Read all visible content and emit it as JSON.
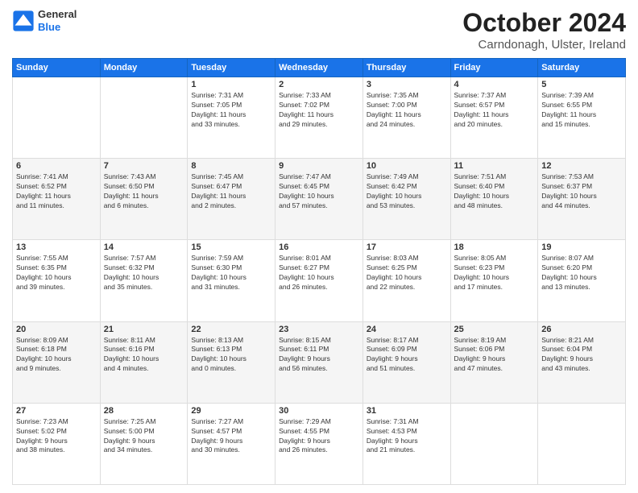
{
  "logo": {
    "line1": "General",
    "line2": "Blue"
  },
  "title": "October 2024",
  "subtitle": "Carndonagh, Ulster, Ireland",
  "days_of_week": [
    "Sunday",
    "Monday",
    "Tuesday",
    "Wednesday",
    "Thursday",
    "Friday",
    "Saturday"
  ],
  "weeks": [
    [
      {
        "day": "",
        "content": ""
      },
      {
        "day": "",
        "content": ""
      },
      {
        "day": "1",
        "content": "Sunrise: 7:31 AM\nSunset: 7:05 PM\nDaylight: 11 hours\nand 33 minutes."
      },
      {
        "day": "2",
        "content": "Sunrise: 7:33 AM\nSunset: 7:02 PM\nDaylight: 11 hours\nand 29 minutes."
      },
      {
        "day": "3",
        "content": "Sunrise: 7:35 AM\nSunset: 7:00 PM\nDaylight: 11 hours\nand 24 minutes."
      },
      {
        "day": "4",
        "content": "Sunrise: 7:37 AM\nSunset: 6:57 PM\nDaylight: 11 hours\nand 20 minutes."
      },
      {
        "day": "5",
        "content": "Sunrise: 7:39 AM\nSunset: 6:55 PM\nDaylight: 11 hours\nand 15 minutes."
      }
    ],
    [
      {
        "day": "6",
        "content": "Sunrise: 7:41 AM\nSunset: 6:52 PM\nDaylight: 11 hours\nand 11 minutes."
      },
      {
        "day": "7",
        "content": "Sunrise: 7:43 AM\nSunset: 6:50 PM\nDaylight: 11 hours\nand 6 minutes."
      },
      {
        "day": "8",
        "content": "Sunrise: 7:45 AM\nSunset: 6:47 PM\nDaylight: 11 hours\nand 2 minutes."
      },
      {
        "day": "9",
        "content": "Sunrise: 7:47 AM\nSunset: 6:45 PM\nDaylight: 10 hours\nand 57 minutes."
      },
      {
        "day": "10",
        "content": "Sunrise: 7:49 AM\nSunset: 6:42 PM\nDaylight: 10 hours\nand 53 minutes."
      },
      {
        "day": "11",
        "content": "Sunrise: 7:51 AM\nSunset: 6:40 PM\nDaylight: 10 hours\nand 48 minutes."
      },
      {
        "day": "12",
        "content": "Sunrise: 7:53 AM\nSunset: 6:37 PM\nDaylight: 10 hours\nand 44 minutes."
      }
    ],
    [
      {
        "day": "13",
        "content": "Sunrise: 7:55 AM\nSunset: 6:35 PM\nDaylight: 10 hours\nand 39 minutes."
      },
      {
        "day": "14",
        "content": "Sunrise: 7:57 AM\nSunset: 6:32 PM\nDaylight: 10 hours\nand 35 minutes."
      },
      {
        "day": "15",
        "content": "Sunrise: 7:59 AM\nSunset: 6:30 PM\nDaylight: 10 hours\nand 31 minutes."
      },
      {
        "day": "16",
        "content": "Sunrise: 8:01 AM\nSunset: 6:27 PM\nDaylight: 10 hours\nand 26 minutes."
      },
      {
        "day": "17",
        "content": "Sunrise: 8:03 AM\nSunset: 6:25 PM\nDaylight: 10 hours\nand 22 minutes."
      },
      {
        "day": "18",
        "content": "Sunrise: 8:05 AM\nSunset: 6:23 PM\nDaylight: 10 hours\nand 17 minutes."
      },
      {
        "day": "19",
        "content": "Sunrise: 8:07 AM\nSunset: 6:20 PM\nDaylight: 10 hours\nand 13 minutes."
      }
    ],
    [
      {
        "day": "20",
        "content": "Sunrise: 8:09 AM\nSunset: 6:18 PM\nDaylight: 10 hours\nand 9 minutes."
      },
      {
        "day": "21",
        "content": "Sunrise: 8:11 AM\nSunset: 6:16 PM\nDaylight: 10 hours\nand 4 minutes."
      },
      {
        "day": "22",
        "content": "Sunrise: 8:13 AM\nSunset: 6:13 PM\nDaylight: 10 hours\nand 0 minutes."
      },
      {
        "day": "23",
        "content": "Sunrise: 8:15 AM\nSunset: 6:11 PM\nDaylight: 9 hours\nand 56 minutes."
      },
      {
        "day": "24",
        "content": "Sunrise: 8:17 AM\nSunset: 6:09 PM\nDaylight: 9 hours\nand 51 minutes."
      },
      {
        "day": "25",
        "content": "Sunrise: 8:19 AM\nSunset: 6:06 PM\nDaylight: 9 hours\nand 47 minutes."
      },
      {
        "day": "26",
        "content": "Sunrise: 8:21 AM\nSunset: 6:04 PM\nDaylight: 9 hours\nand 43 minutes."
      }
    ],
    [
      {
        "day": "27",
        "content": "Sunrise: 7:23 AM\nSunset: 5:02 PM\nDaylight: 9 hours\nand 38 minutes."
      },
      {
        "day": "28",
        "content": "Sunrise: 7:25 AM\nSunset: 5:00 PM\nDaylight: 9 hours\nand 34 minutes."
      },
      {
        "day": "29",
        "content": "Sunrise: 7:27 AM\nSunset: 4:57 PM\nDaylight: 9 hours\nand 30 minutes."
      },
      {
        "day": "30",
        "content": "Sunrise: 7:29 AM\nSunset: 4:55 PM\nDaylight: 9 hours\nand 26 minutes."
      },
      {
        "day": "31",
        "content": "Sunrise: 7:31 AM\nSunset: 4:53 PM\nDaylight: 9 hours\nand 21 minutes."
      },
      {
        "day": "",
        "content": ""
      },
      {
        "day": "",
        "content": ""
      }
    ]
  ]
}
